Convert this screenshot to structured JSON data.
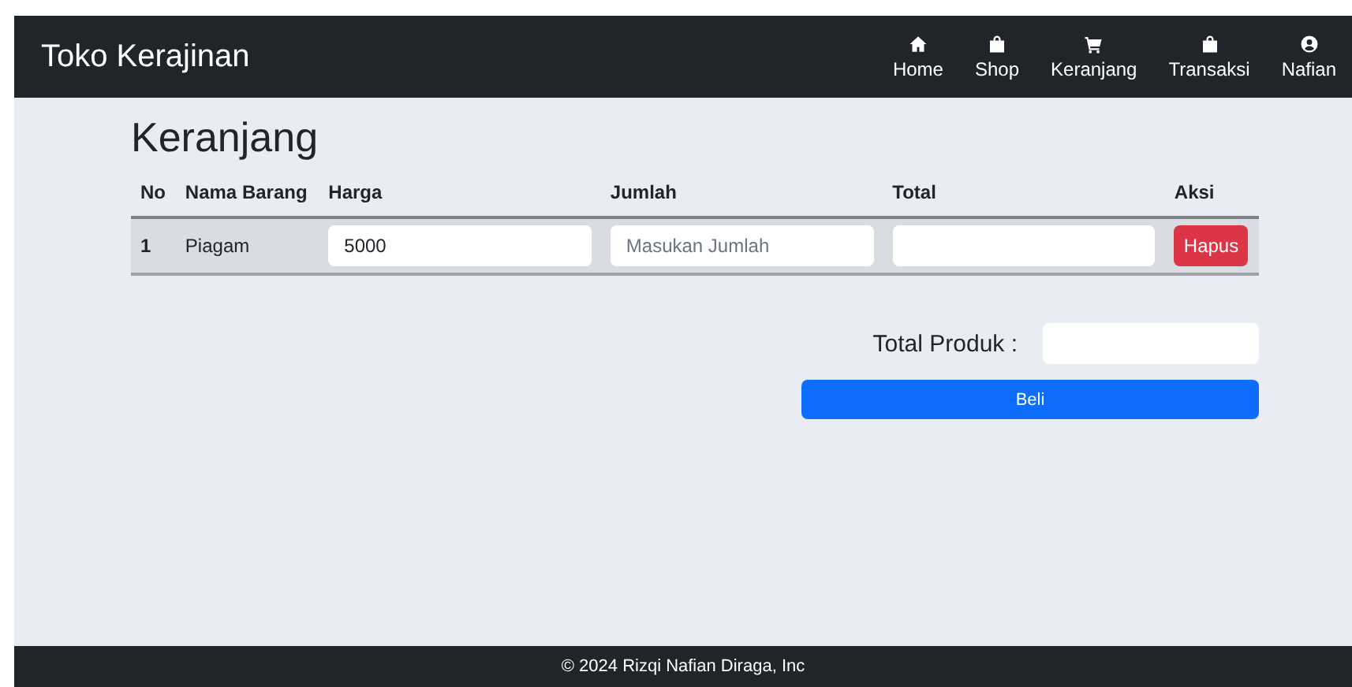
{
  "navbar": {
    "brand": "Toko Kerajinan",
    "items": [
      {
        "label": "Home",
        "kind": "home"
      },
      {
        "label": "Shop",
        "kind": "bag"
      },
      {
        "label": "Keranjang",
        "kind": "cart"
      },
      {
        "label": "Transaksi",
        "kind": "bag"
      },
      {
        "label": "Nafian",
        "kind": "user"
      }
    ]
  },
  "page_title": "Keranjang",
  "table": {
    "columns": [
      "No",
      "Nama Barang",
      "Harga",
      "Jumlah",
      "Total",
      "Aksi"
    ],
    "rows": [
      {
        "no": "1",
        "name": "Piagam",
        "price": {
          "value": "5000"
        },
        "quantity": {
          "placeholder": "Masukan Jumlah"
        },
        "action": "Hapus"
      }
    ]
  },
  "summary": {
    "label": "Total Produk :",
    "button": "Beli"
  },
  "footer": "© 2024 Rizqi Nafian Diraga, Inc"
}
